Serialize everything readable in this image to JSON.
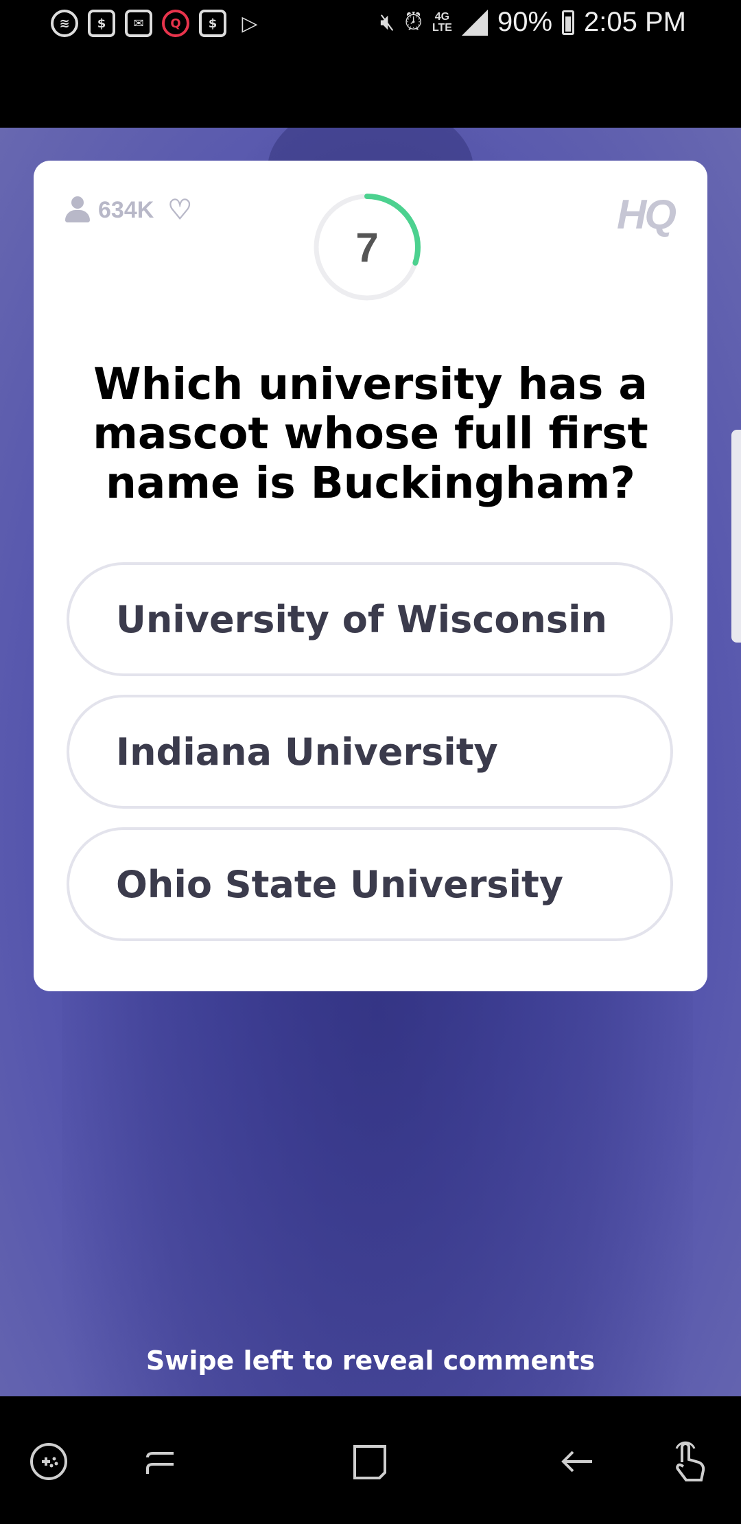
{
  "status_bar": {
    "battery": "90%",
    "time": "2:05 PM",
    "network": "4G LTE",
    "notification_icons": [
      "spotify-icon",
      "dollar-icon",
      "mail-icon",
      "hq-q-icon",
      "dollar-icon",
      "play-store-icon"
    ]
  },
  "card": {
    "viewer_count": "634K",
    "timer": "7",
    "timer_progress": 0.3,
    "logo": "HQ",
    "question": "Which university has a mascot whose full first name is Buckingham?",
    "answers": [
      "University of Wisconsin",
      "Indiana University",
      "Ohio State University"
    ]
  },
  "hint": "Swipe left to reveal comments",
  "colors": {
    "timer_accent": "#4cd18f",
    "background": "#4a4ba8",
    "card": "#ffffff"
  },
  "nav_bar": {
    "icons": [
      "game-launcher-icon",
      "recent-apps-icon",
      "home-icon",
      "back-icon",
      "touch-icon"
    ]
  }
}
